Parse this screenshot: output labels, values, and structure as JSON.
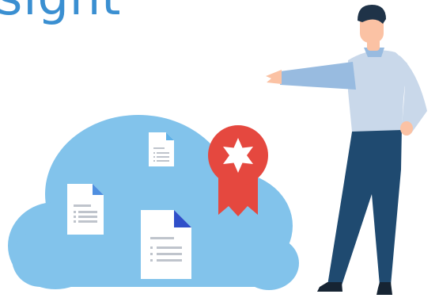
{
  "heading": {
    "text": "sight",
    "color": "#3a8fd1"
  },
  "colors": {
    "cloud": "#82c3eb",
    "document_paper": "#ffffff",
    "document_fold_light": "#5fb1e8",
    "document_fold_medium": "#4f8fe0",
    "document_fold_dark": "#2f4fc9",
    "document_lines": "#bfc4cc",
    "badge": "#e5483f",
    "badge_star": "#ffffff",
    "shirt": "#c9d8ea",
    "sleeve": "#98bbe0",
    "trousers": "#1f4a70",
    "hair": "#1f3348",
    "skin": "#fbc2a4",
    "shoes": "#162433"
  },
  "icons": [
    "cloud",
    "document-icon",
    "award-ribbon-icon",
    "person-pointing"
  ]
}
